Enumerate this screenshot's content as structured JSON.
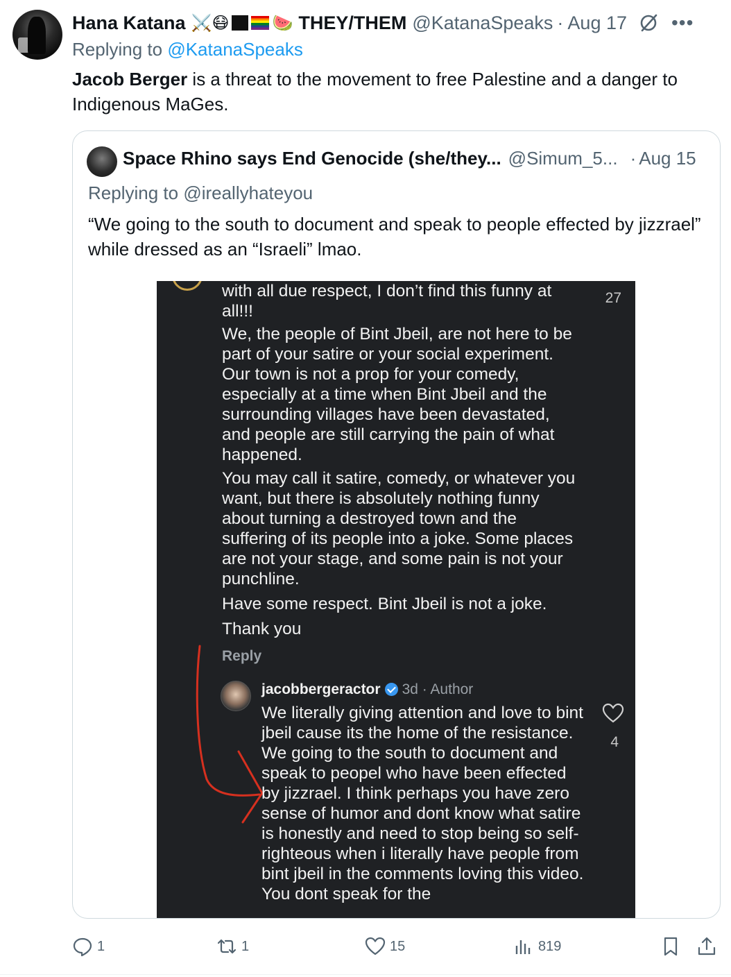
{
  "tweet": {
    "author_name": "Hana Katana",
    "emoji_string": "⚔️😷",
    "watermelon": "🍉",
    "pronouns": "THEY/THEM",
    "handle": "@KatanaSpeaks",
    "separator": "·",
    "date": "Aug 17",
    "replying_prefix": "Replying to",
    "replying_to": "@KatanaSpeaks",
    "text_bold": "Jacob Berger",
    "text_rest": "is a threat to the movement to free Palestine and a danger to Indigenous MaGes."
  },
  "quoted": {
    "author_name": "Space Rhino says End Genocide (she/they...",
    "handle": "@Simum_5...",
    "separator": "·",
    "date": "Aug 15",
    "replying_prefix": "Replying to",
    "replying_to": "@ireallyhateyou",
    "text": "“We going to the south to document and speak to people effected by jizzrael” while dressed as an “Israeli” lmao."
  },
  "screenshot": {
    "top_like_count": "27",
    "comment_p1": "with all due respect, I don’t find this funny at all!!!",
    "comment_p2": "We, the people of Bint Jbeil, are not here to be part of your satire or your social experiment. Our town is not a prop for your comedy, especially at a time when Bint Jbeil and the surrounding villages have been devastated, and people are still carrying the pain of what happened.",
    "comment_p3": "You may call it satire, comedy, or whatever you want, but there is absolutely nothing funny about turning a destroyed town and the suffering of its people into a joke. Some places are not your stage, and some pain is not your punchline.",
    "comment_p4": "Have some respect. Bint Jbeil is not a joke.",
    "comment_p5": "Thank you",
    "reply_label": "Reply",
    "reply_user": "jacobbergeractor",
    "reply_meta": "3d · Author",
    "reply_text": "We literally giving attention and love to bint jbeil cause its the home of the resistance. We going to the south to document and speak to peopel who have been effected by jizzrael. I think perhaps you have zero sense of humor and dont know what satire is honestly and need to stop being so self-righteous when i literally have people from bint jbeil in the comments loving this video. You dont speak for the",
    "reply_like_count": "4"
  },
  "actions": {
    "replies": "1",
    "reposts": "1",
    "likes": "15",
    "views": "819"
  },
  "colors": {
    "link": "#1d9bf0",
    "secondary": "#536471",
    "screenshot_bg": "#1f2124",
    "annotation_arrow": "#d6301f"
  }
}
